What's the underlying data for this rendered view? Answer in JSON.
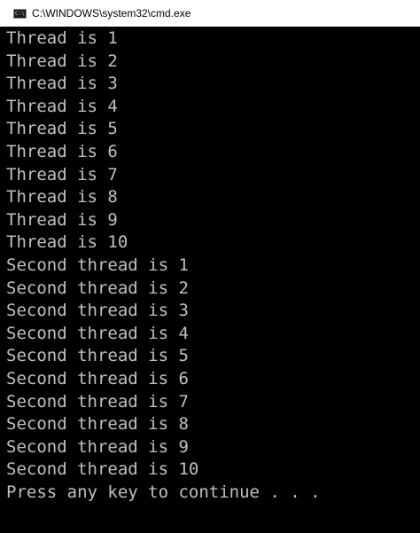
{
  "window": {
    "title": "C:\\WINDOWS\\system32\\cmd.exe",
    "icon": "cmd-console-icon",
    "icon_glyph": "C:\\"
  },
  "console": {
    "lines": [
      "Thread is 1",
      "Thread is 2",
      "Thread is 3",
      "Thread is 4",
      "Thread is 5",
      "Thread is 6",
      "Thread is 7",
      "Thread is 8",
      "Thread is 9",
      "Thread is 10",
      "Second thread is 1",
      "Second thread is 2",
      "Second thread is 3",
      "Second thread is 4",
      "Second thread is 5",
      "Second thread is 6",
      "Second thread is 7",
      "Second thread is 8",
      "Second thread is 9",
      "Second thread is 10",
      "Press any key to continue . . ."
    ],
    "text_color": "#c0c0c0",
    "background_color": "#000000"
  }
}
